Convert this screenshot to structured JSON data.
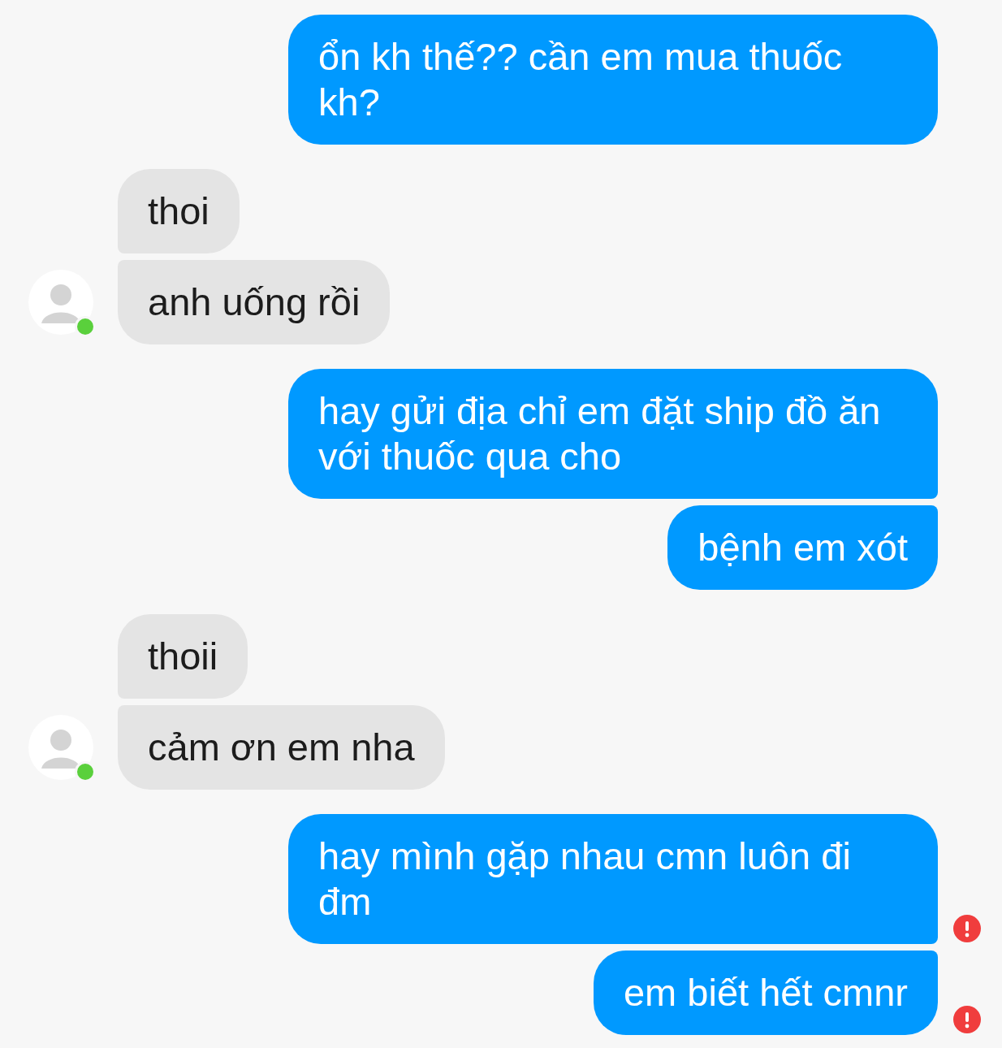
{
  "messages": [
    {
      "kind": "sent",
      "text": "ổn kh thế?? cần em mua thuốc kh?",
      "failed": false
    },
    {
      "kind": "received",
      "text": "thoi"
    },
    {
      "kind": "received",
      "text": "anh uống rồi",
      "avatar": {
        "online": true
      }
    },
    {
      "kind": "sent",
      "text": "hay gửi địa chỉ em đặt ship đồ ăn với thuốc qua cho",
      "failed": false
    },
    {
      "kind": "sent",
      "text": "bệnh em xót",
      "failed": false
    },
    {
      "kind": "received",
      "text": "thoii"
    },
    {
      "kind": "received",
      "text": "cảm ơn em nha",
      "avatar": {
        "online": true
      }
    },
    {
      "kind": "sent",
      "text": "hay mình gặp nhau cmn luôn đi đm",
      "failed": true
    },
    {
      "kind": "sent",
      "text": "em biết hết cmnr",
      "failed": true
    }
  ]
}
